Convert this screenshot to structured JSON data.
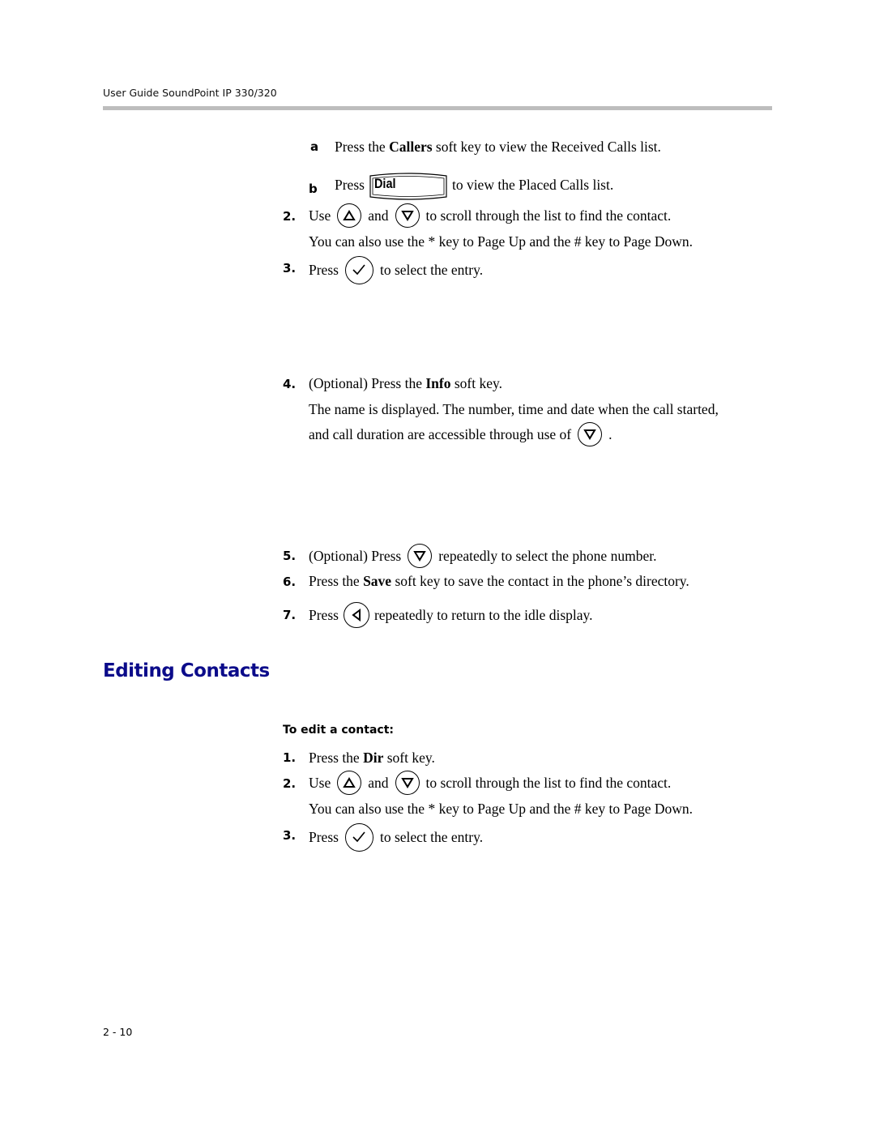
{
  "header": {
    "title": "User Guide SoundPoint IP 330/320"
  },
  "steps_top": {
    "substep_a": {
      "marker": "a",
      "pre": "Press the ",
      "bold": "Callers",
      "post": " soft key to view the Received Calls list."
    },
    "substep_b": {
      "marker": "b",
      "pre": "Press",
      "key_label": "Dial",
      "post": "to view the Placed Calls list."
    },
    "step2": {
      "marker": "2.",
      "pre": "Use",
      "mid": "and",
      "post": "to scroll through the list to find the contact.",
      "note": "You can also use the * key to Page Up and the # key to Page Down."
    },
    "step3": {
      "marker": "3.",
      "pre": "Press",
      "post": "to select the entry."
    },
    "step4": {
      "marker": "4.",
      "pre": "(Optional) Press the ",
      "bold": "Info",
      "post": " soft key.",
      "note1": "The name is displayed. The number, time and date when the call started,",
      "note2": "and call duration are accessible through use of",
      "note2_end": "."
    },
    "step5": {
      "marker": "5.",
      "pre": "(Optional) Press",
      "post": "repeatedly to select the phone number."
    },
    "step6": {
      "marker": "6.",
      "pre": "Press the ",
      "bold": "Save",
      "post": " soft key to save the contact in the phone’s directory."
    },
    "step7": {
      "marker": "7.",
      "pre": "Press",
      "post": "repeatedly to return to the idle display."
    }
  },
  "section": {
    "title": "Editing Contacts",
    "procedure_title": "To edit a contact:",
    "step1": {
      "marker": "1.",
      "pre": "Press the ",
      "bold": "Dir",
      "post": " soft key."
    },
    "step2": {
      "marker": "2.",
      "pre": "Use",
      "mid": "and",
      "post": "to scroll through the list to find the contact.",
      "note": "You can also use the * key to Page Up and the # key to Page Down."
    },
    "step3": {
      "marker": "3.",
      "pre": "Press",
      "post": "to select the entry."
    }
  },
  "icons": {
    "up": "up-arrow-key",
    "down": "down-arrow-key",
    "select": "select-check-key",
    "left": "left-arrow-key",
    "dial": "dial-soft-key"
  },
  "colors": {
    "section_title": "#0b0b8a",
    "header_rule": "#bdbdbd"
  },
  "footer": {
    "page_number": "2 - 10"
  }
}
